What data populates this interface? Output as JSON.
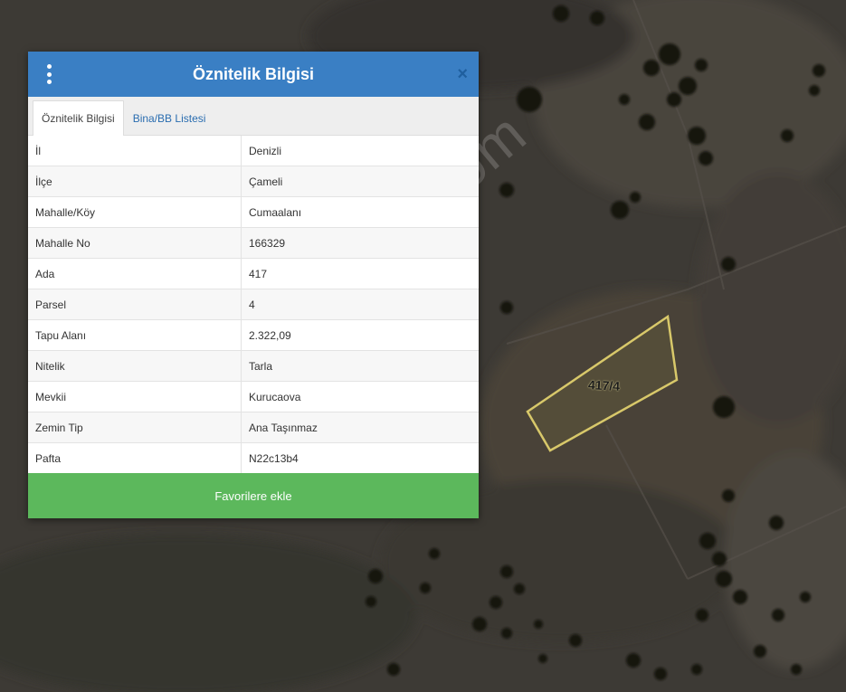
{
  "dialog": {
    "title": "Öznitelik Bilgisi",
    "menu_icon": "vertical-dots-icon",
    "close_icon": "close-icon",
    "close_label": "×"
  },
  "tabs": [
    {
      "label": "Öznitelik Bilgisi",
      "active": true
    },
    {
      "label": "Bina/BB Listesi",
      "active": false
    }
  ],
  "attributes": [
    {
      "key": "İl",
      "value": "Denizli"
    },
    {
      "key": "İlçe",
      "value": "Çameli"
    },
    {
      "key": "Mahalle/Köy",
      "value": "Cumaalanı"
    },
    {
      "key": "Mahalle No",
      "value": "166329"
    },
    {
      "key": "Ada",
      "value": "417"
    },
    {
      "key": "Parsel",
      "value": "4"
    },
    {
      "key": "Tapu Alanı",
      "value": "2.322,09"
    },
    {
      "key": "Nitelik",
      "value": "Tarla"
    },
    {
      "key": "Mevkii",
      "value": "Kurucaova"
    },
    {
      "key": "Zemin Tip",
      "value": "Ana Taşınmaz"
    },
    {
      "key": "Pafta",
      "value": "N22c13b4"
    }
  ],
  "favorite_button": "Favorilere ekle",
  "map": {
    "parcel_label": "417/4",
    "watermark": "emlakjet.com"
  },
  "colors": {
    "header": "#3a7fc4",
    "favorite_button": "#5cb85c",
    "parcel_outline": "#d8c86a"
  }
}
